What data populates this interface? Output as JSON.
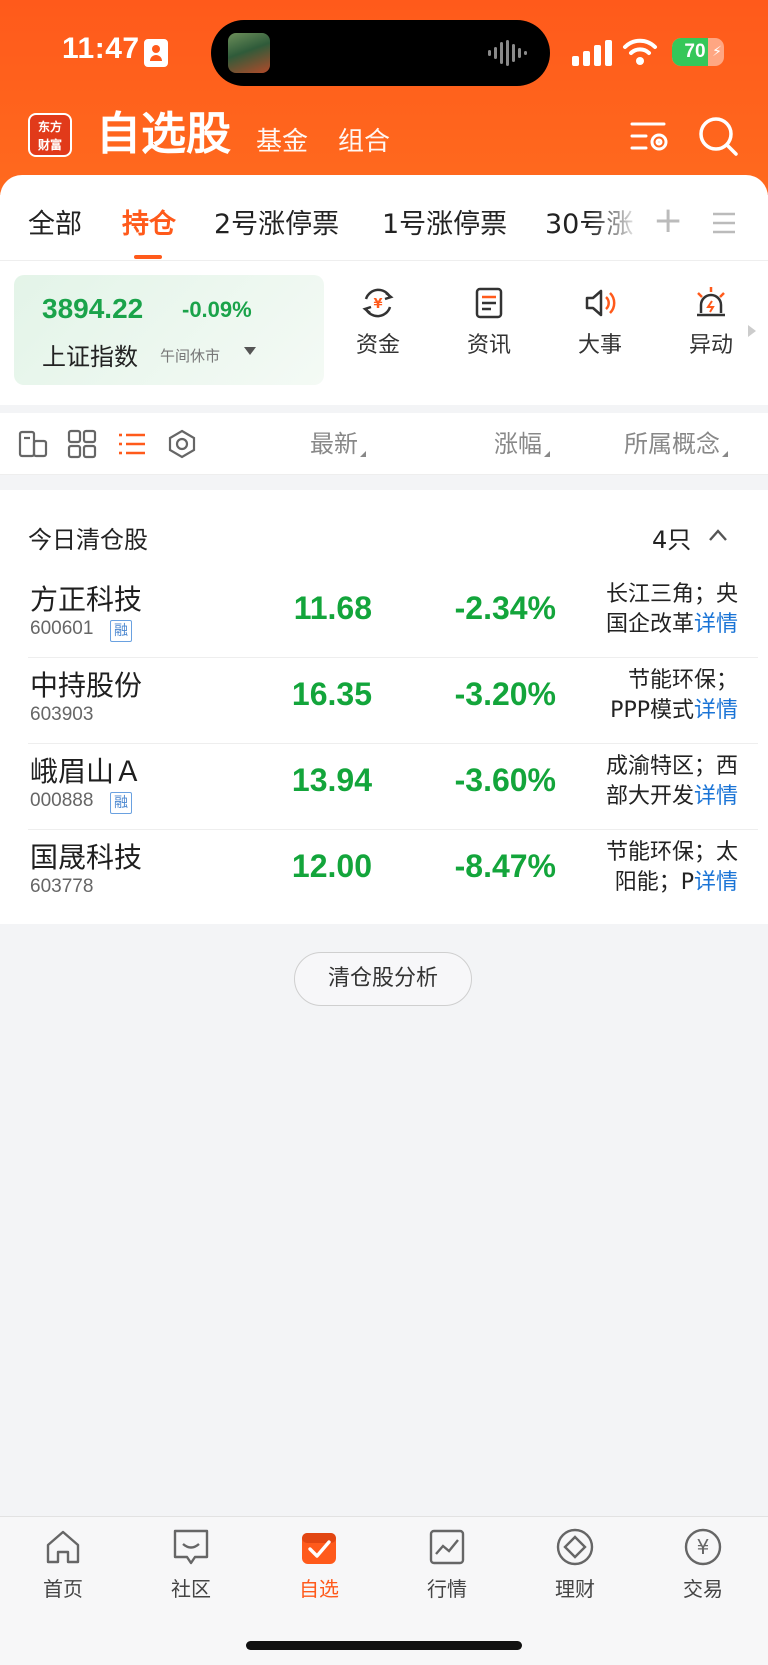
{
  "status_bar": {
    "time": "11:47",
    "battery": "70",
    "battery_level": 0.7
  },
  "header": {
    "logo_line1": "东方",
    "logo_line2": "财富",
    "title": "自选股",
    "tabs": [
      "基金",
      "组合"
    ]
  },
  "group_tabs": {
    "items": [
      "全部",
      "持仓",
      "2号涨停票",
      "1号涨停票",
      "30号涨"
    ],
    "active": "持仓",
    "add": "+"
  },
  "index_card": {
    "price": "3894.22",
    "change": "-0.09%",
    "name": "上证指数",
    "status": "午间休市"
  },
  "quick_links": [
    "资金",
    "资讯",
    "大事",
    "异动"
  ],
  "list_header": {
    "latest": "最新",
    "change": "涨幅",
    "concept": "所属概念"
  },
  "cleared_section": {
    "title": "今日清仓股",
    "count": "4只",
    "rows": [
      {
        "name": "方正科技",
        "code": "600601",
        "badge": "融",
        "price": "11.68",
        "change": "-2.34%",
        "concept_l1": "长江三角；央",
        "concept_l2": "国企改革",
        "more": "详情"
      },
      {
        "name": "中持股份",
        "code": "603903",
        "badge": "",
        "price": "16.35",
        "change": "-3.20%",
        "concept_l1": "节能环保；",
        "concept_l2": "PPP模式",
        "more": "详情"
      },
      {
        "name": "峨眉山Ａ",
        "code": "000888",
        "badge": "融",
        "price": "13.94",
        "change": "-3.60%",
        "concept_l1": "成渝特区；西",
        "concept_l2": "部大开发",
        "more": "详情"
      },
      {
        "name": "国晟科技",
        "code": "603778",
        "badge": "",
        "price": "12.00",
        "change": "-8.47%",
        "concept_l1": "节能环保；太",
        "concept_l2": "阳能；P",
        "more": "详情"
      }
    ],
    "analysis_button": "清仓股分析"
  },
  "bottom_nav": {
    "items": [
      "首页",
      "社区",
      "自选",
      "行情",
      "理财",
      "交易"
    ],
    "active": "自选"
  },
  "colors": {
    "brand": "#ff5a1b",
    "down": "#13a53b",
    "link": "#1a74d6"
  },
  "icons": {
    "quick_links": [
      "fund-flow-icon",
      "news-icon",
      "speaker-icon",
      "alarm-icon"
    ],
    "bottom_nav": [
      "home-icon",
      "community-icon",
      "watchlist-icon",
      "market-icon",
      "wealth-icon",
      "trade-icon"
    ]
  }
}
